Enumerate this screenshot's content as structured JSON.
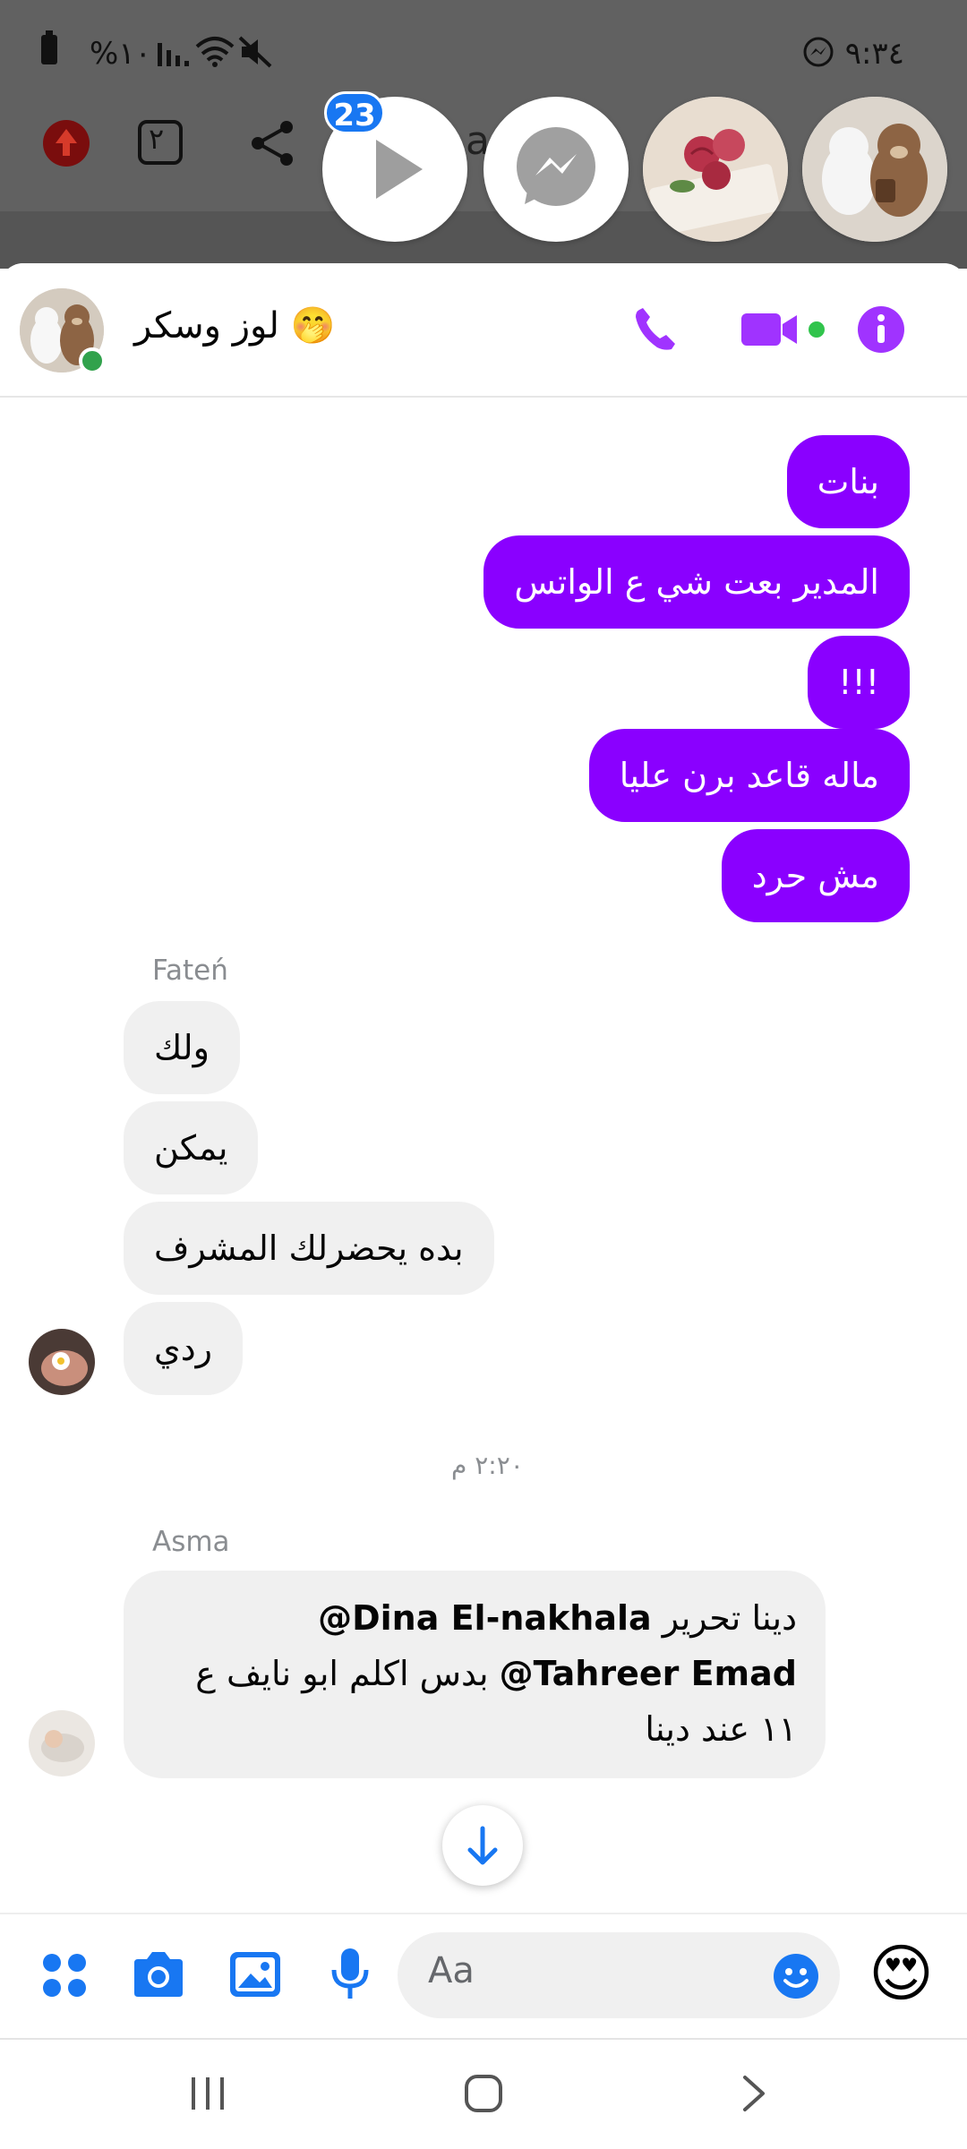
{
  "status_bar": {
    "left_text": "%١٠٠",
    "time": "٩:٣٤"
  },
  "background_page": {
    "tab_count": "٢",
    "partial_text": "a      m       e"
  },
  "chat_heads": {
    "badge_count": "23"
  },
  "header": {
    "title": "لوز وسكر 🤭",
    "accent": "#a033ff"
  },
  "messages": {
    "outgoing": [
      "بنات",
      "المدير بعت شي ع الواتس",
      "!!!",
      "ماله قاعد برن عليا",
      "مش حرد"
    ],
    "group1": {
      "sender": "Fateń",
      "items": [
        "ولك",
        "يمكن",
        "بده يحضرلك المشرف",
        "ردي"
      ]
    },
    "timestamp": "٢:٢٠ م",
    "group2": {
      "sender": "Asma",
      "line1_text": "دينا تحرير ",
      "line1_mention": "@Dina El-nakhala",
      "line2_mention": "@Tahreer Emad",
      "line2_text": " بدس اكلم ابو نايف  ع",
      "line3_text": "١١ عند دينا"
    }
  },
  "composer": {
    "placeholder": "Aa",
    "quick_reaction": "😍"
  },
  "colors": {
    "outgoing_bubble": "#8a00ff",
    "incoming_bubble": "#f0f0f0",
    "messenger_blue": "#1877f2",
    "online": "#31a24c"
  }
}
